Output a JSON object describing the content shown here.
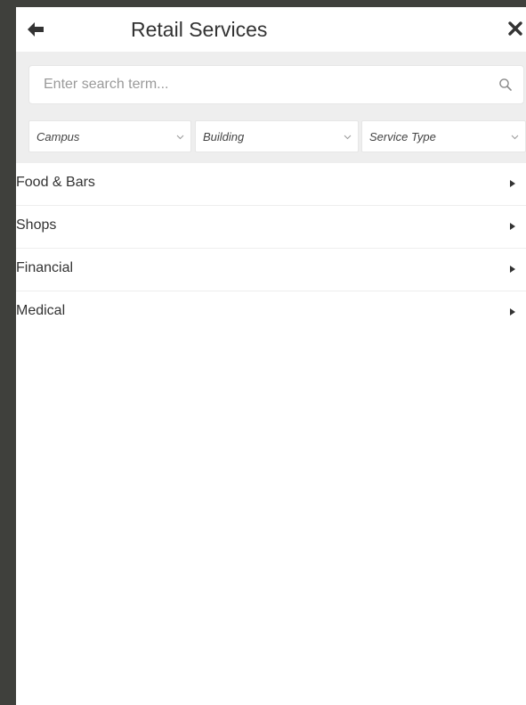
{
  "header": {
    "title": "Retail Services",
    "back_icon": "arrow-left-icon",
    "close_icon": "close-icon"
  },
  "search": {
    "placeholder": "Enter search term...",
    "value": "",
    "icon": "search-icon"
  },
  "filters": [
    {
      "label": "Campus"
    },
    {
      "label": "Building"
    },
    {
      "label": "Service Type"
    }
  ],
  "categories": [
    {
      "label": "Food & Bars"
    },
    {
      "label": "Shops"
    },
    {
      "label": "Financial"
    },
    {
      "label": "Medical"
    }
  ],
  "colors": {
    "background": "#3f403c",
    "panel": "#ffffff",
    "filter_bar": "#eeeeee",
    "text": "#333333"
  }
}
